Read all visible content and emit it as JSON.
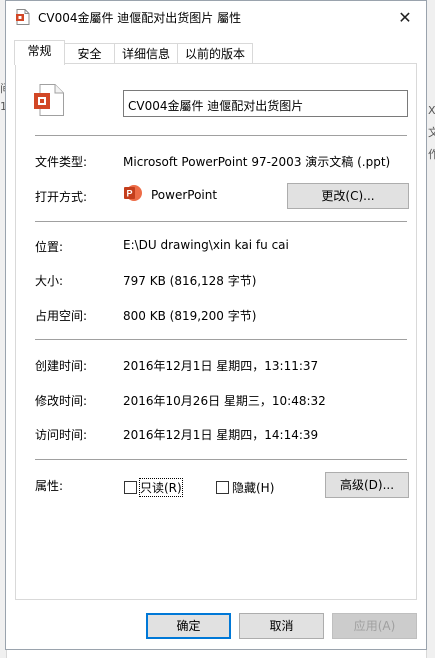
{
  "window": {
    "title": "CV004金屬件 迪偃配对出货图片 屬性"
  },
  "tabs": [
    {
      "label": "常规",
      "active": true
    },
    {
      "label": "安全"
    },
    {
      "label": "详细信息"
    },
    {
      "label": "以前的版本"
    }
  ],
  "general": {
    "file_name": "CV004金屬件 迪偃配对出货图片",
    "file_type_label": "文件类型:",
    "file_type_value": "Microsoft PowerPoint 97-2003 演示文稿 (.ppt)",
    "opens_with_label": "打开方式:",
    "opens_with_app": "PowerPoint",
    "change_button": "更改(C)...",
    "location_label": "位置:",
    "location_value": "E:\\DU drawing\\xin kai fu cai",
    "size_label": "大小:",
    "size_value": "797 KB (816,128 字节)",
    "size_on_disk_label": "占用空间:",
    "size_on_disk_value": "800 KB (819,200 字节)",
    "created_label": "创建时间:",
    "created_value": "2016年12月1日 星期四，13:11:37",
    "modified_label": "修改时间:",
    "modified_value": "2016年10月26日 星期三，10:48:32",
    "accessed_label": "访问时间:",
    "accessed_value": "2016年12月1日 星期四，14:14:39",
    "attributes_label": "属性:",
    "readonly_label": "只读(R)",
    "readonly_checked": false,
    "hidden_label": "隐藏(H)",
    "hidden_checked": false,
    "advanced_button": "高级(D)..."
  },
  "footer": {
    "ok": "确定",
    "cancel": "取消",
    "apply": "应用(A)"
  },
  "background": {
    "left_fragments": [
      "间",
      "1:"
    ],
    "right_fragments": [
      "X",
      "文",
      "作"
    ]
  },
  "colors": {
    "accent": "#0078d7",
    "powerpoint": "#d24726"
  },
  "icons": [
    "ppt-file-icon",
    "close-icon",
    "powerpoint-app-icon"
  ]
}
